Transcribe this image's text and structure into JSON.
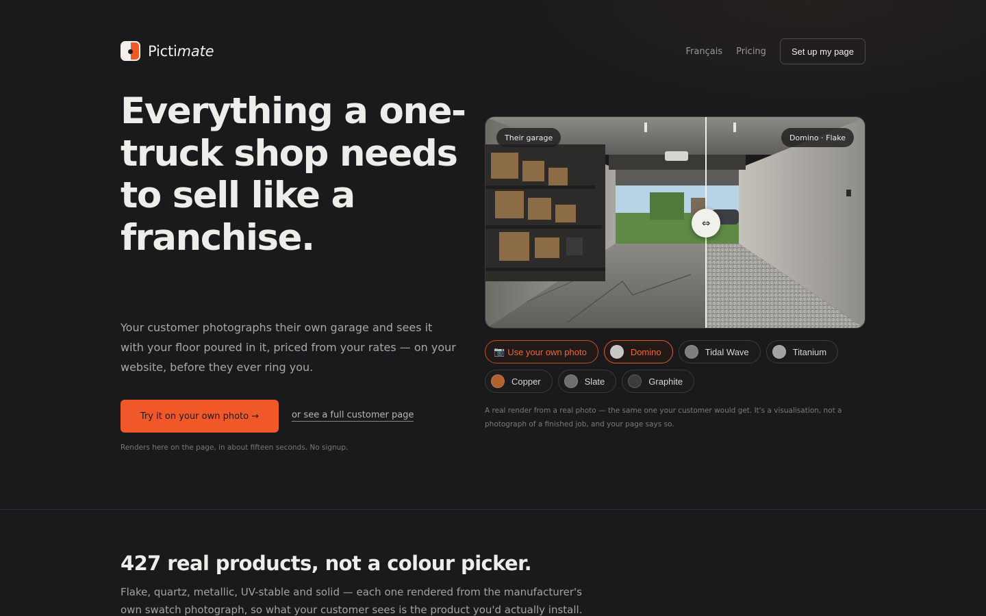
{
  "brand": {
    "name_plain": "Picti",
    "name_italic": "mate"
  },
  "nav": {
    "links": [
      "Français",
      "Pricing"
    ],
    "cta_label": "Set up my page"
  },
  "hero": {
    "title": "Everything a one-truck shop needs to sell like a franchise.",
    "subtitle": "Your customer photographs their own garage and sees it with your floor poured in it, priced from your rates — on your website, before they ever ring you.",
    "cta_label": "Try it on your own photo →",
    "cta_alt_label": "or see a full customer page",
    "note": "Renders here on the page, in about fifteen seconds. No signup."
  },
  "compare": {
    "left_tag": "Their garage",
    "right_tag": "Domino · Flake",
    "handle_glyph": "⇔",
    "split_fraction": 0.58
  },
  "chips": {
    "upload_label": "Use your own photo",
    "upload_icon": "camera-icon",
    "row1": [
      {
        "label": "Domino",
        "color": "#c9c7c2",
        "active": true
      },
      {
        "label": "Tidal Wave",
        "color": "#7d7d7d",
        "active": false
      },
      {
        "label": "Titanium",
        "color": "#a3a3a3",
        "active": false
      }
    ],
    "row2": [
      {
        "label": "Copper",
        "color": "#b0622f",
        "active": false
      },
      {
        "label": "Slate",
        "color": "#6e6e6e",
        "active": false
      },
      {
        "label": "Graphite",
        "color": "#3c3c3c",
        "active": false
      }
    ]
  },
  "disclaimer": "A real render from a real photo — the same one your customer would get. It's a visualisation, not a photograph of a finished job, and your page says so.",
  "section2": {
    "title": "427 real products, not a colour picker.",
    "body": "Flake, quartz, metallic, UV-stable and solid — each one rendered from the manufacturer's own swatch photograph, so what your customer sees is the product you'd actually install. You choose"
  },
  "colors": {
    "accent": "#f0582a",
    "background": "#1a1a1c"
  }
}
